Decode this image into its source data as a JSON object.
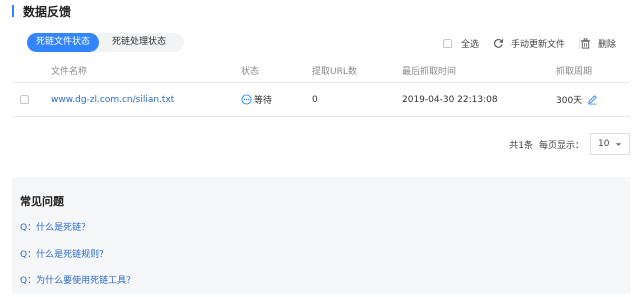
{
  "header": {
    "title": "数据反馈"
  },
  "tabs": [
    {
      "label": "死链文件状态",
      "active": true
    },
    {
      "label": "死链处理状态",
      "active": false
    }
  ],
  "toolbar": {
    "select_all_label": "全选",
    "update_label": "手动更新文件",
    "delete_label": "删除"
  },
  "table": {
    "headers": [
      "文件名称",
      "状态",
      "提取URL数",
      "最后抓取时间",
      "抓取周期"
    ],
    "rows": [
      {
        "file": "www.dg-zl.com.cn/silian.txt",
        "status": "等待",
        "url_count": "0",
        "last_crawl": "2019-04-30 22:13:08",
        "period": "300天"
      }
    ]
  },
  "pager": {
    "total": "共1条",
    "per_page_label": "每页显示：",
    "per_page_value": "10"
  },
  "faq": {
    "title": "常见问题",
    "items": [
      "Q：什么是死链？",
      "Q：什么是死链规则？",
      "Q：为什么要使用死链工具？"
    ]
  },
  "colors": {
    "accent": "#3385ff",
    "link": "#2b6bc9",
    "faq_bg": "#f5f6f7"
  },
  "icons": {
    "status": "waiting-dots-icon",
    "edit": "pencil-icon",
    "update": "refresh-icon",
    "delete": "trash-icon"
  }
}
